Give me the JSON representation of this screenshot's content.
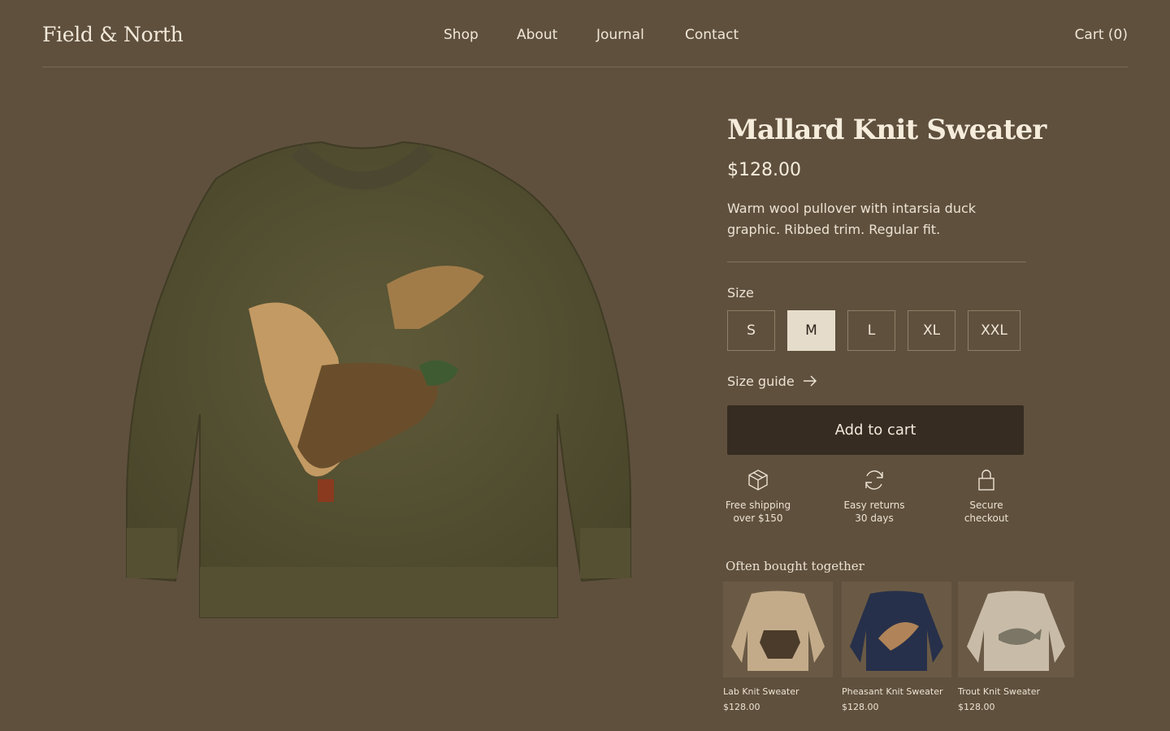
{
  "brand": "Field & North",
  "nav": [
    "Shop",
    "About",
    "Journal",
    "Contact"
  ],
  "cart": "Cart (0)",
  "product": {
    "title": "Mallard Knit Sweater",
    "price": "$128.00",
    "description": "Warm wool pullover with intarsia duck graphic. Ribbed trim. Regular fit.",
    "size_label": "Size",
    "sizes": [
      "S",
      "M",
      "L",
      "XL",
      "XXL"
    ],
    "selected_size": "M",
    "size_guide": "Size guide",
    "add_to_cart": "Add to cart",
    "image_icon": "mallard-sweater-image"
  },
  "features": [
    {
      "icon": "box-icon",
      "line1": "Free shipping",
      "line2": "over $150"
    },
    {
      "icon": "refresh-icon",
      "line1": "Easy returns",
      "line2": "30 days"
    },
    {
      "icon": "lock-icon",
      "line1": "Secure",
      "line2": "checkout"
    }
  ],
  "related": {
    "title": "Often bought together",
    "items": [
      {
        "name": "Lab Knit Sweater",
        "price": "$128.00",
        "color": "#c3ab8a"
      },
      {
        "name": "Pheasant Knit Sweater",
        "price": "$128.00",
        "color": "#27304a"
      },
      {
        "name": "Trout Knit Sweater",
        "price": "$128.00",
        "color": "#c8bca8"
      }
    ]
  },
  "colors": {
    "background": "#5f503d",
    "button": "#362c21",
    "sweater": "#5a5535"
  }
}
